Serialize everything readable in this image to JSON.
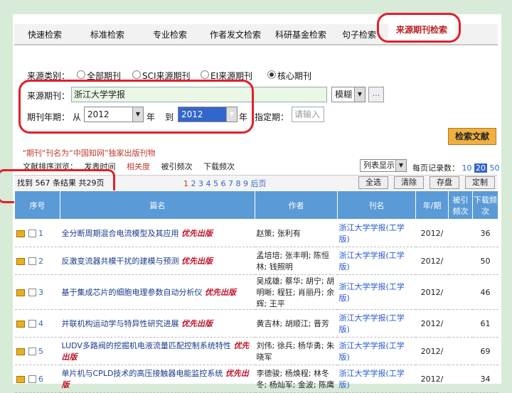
{
  "tabs": [
    "快速检索",
    "标准检索",
    "专业检索",
    "作者发文检索",
    "科研基金检索",
    "句子检索",
    "来源期刊检索"
  ],
  "form": {
    "source_type_label": "来源类别：",
    "source_types": [
      "全部期刊",
      "SCI来源期刊",
      "EI来源期刊",
      "核心期刊"
    ],
    "journal_label": "来源期刊：",
    "journal_value": "浙江大学学报",
    "match_mode": "模糊",
    "more_symbol": "...",
    "year_label": "期刊年期：",
    "from_label": "从",
    "year_from": "2012",
    "year_unit": "年",
    "to_label": "到",
    "year_to": "2012",
    "issue_label": "指定期：",
    "issue_placeholder": "请输入",
    "search_button": "检索文献"
  },
  "note": "\"期刊\"刊名为“中国知网”独家出版刊物",
  "sort": {
    "label": "文献排序浏览：",
    "options": [
      "发表时间",
      "相关度",
      "被引频次",
      "下载频次"
    ],
    "display_mode": "列表显示",
    "per_page_label": "每页记录数：",
    "per_page_options": [
      "10",
      "20",
      "50"
    ]
  },
  "result": {
    "summary": "找到 567 条结果  共29页",
    "pages": [
      "1",
      "2",
      "3",
      "4",
      "5",
      "6",
      "7",
      "8",
      "9"
    ],
    "next": "后页",
    "actions": [
      "全选",
      "清除",
      "存盘",
      "定制"
    ]
  },
  "table": {
    "headers": [
      "序号",
      "篇名",
      "作者",
      "刊名",
      "年/期",
      "被引频次",
      "下载频次"
    ],
    "tag": "优先出版",
    "rows": [
      {
        "no": "1",
        "title": "全分断周期混合电流模型及其应用",
        "authors": "赵策; 张利有",
        "source": "浙江大学学报(工学版)",
        "year": "2012/",
        "cited": "",
        "downloads": "36"
      },
      {
        "no": "2",
        "title": "反激变流器共模干扰的建模与预测",
        "authors": "孟培培; 张丰明; 陈恒林; 钱照明",
        "source": "浙江大学学报(工学版)",
        "year": "2012/",
        "cited": "",
        "downloads": "50"
      },
      {
        "no": "3",
        "title": "基于集成芯片的细胞电理参数自动分析仪",
        "authors": "吴成雄; 蔡华; 胡宁; 胡明晰; 程狂; 肖丽丹; 余辉; 王平",
        "source": "浙江大学学报(工学版)",
        "year": "2012/",
        "cited": "",
        "downloads": "46"
      },
      {
        "no": "4",
        "title": "并联机构运动学与特异性研究进展",
        "authors": "黄吉林; 胡顺江; 晋芳",
        "source": "浙江大学学报(工学版)",
        "year": "2012/",
        "cited": "",
        "downloads": "61"
      },
      {
        "no": "5",
        "title": "LUDV多路阀的挖掘机电液流量匹配控制系统特性",
        "authors": "刘伟; 徐兵; 杨华勇; 朱晓军",
        "source": "浙江大学学报(工学版)",
        "year": "2012/",
        "cited": "",
        "downloads": "69"
      },
      {
        "no": "6",
        "title": "单片机与CPLD技术的高压接触器电能监控系统",
        "authors": "李德骏; 杨焕程; 林冬冬; 杨灿军; 金波; 陈鹰",
        "source": "浙江大学学报(工学版)",
        "year": "2012/",
        "cited": "",
        "downloads": "34"
      }
    ]
  }
}
